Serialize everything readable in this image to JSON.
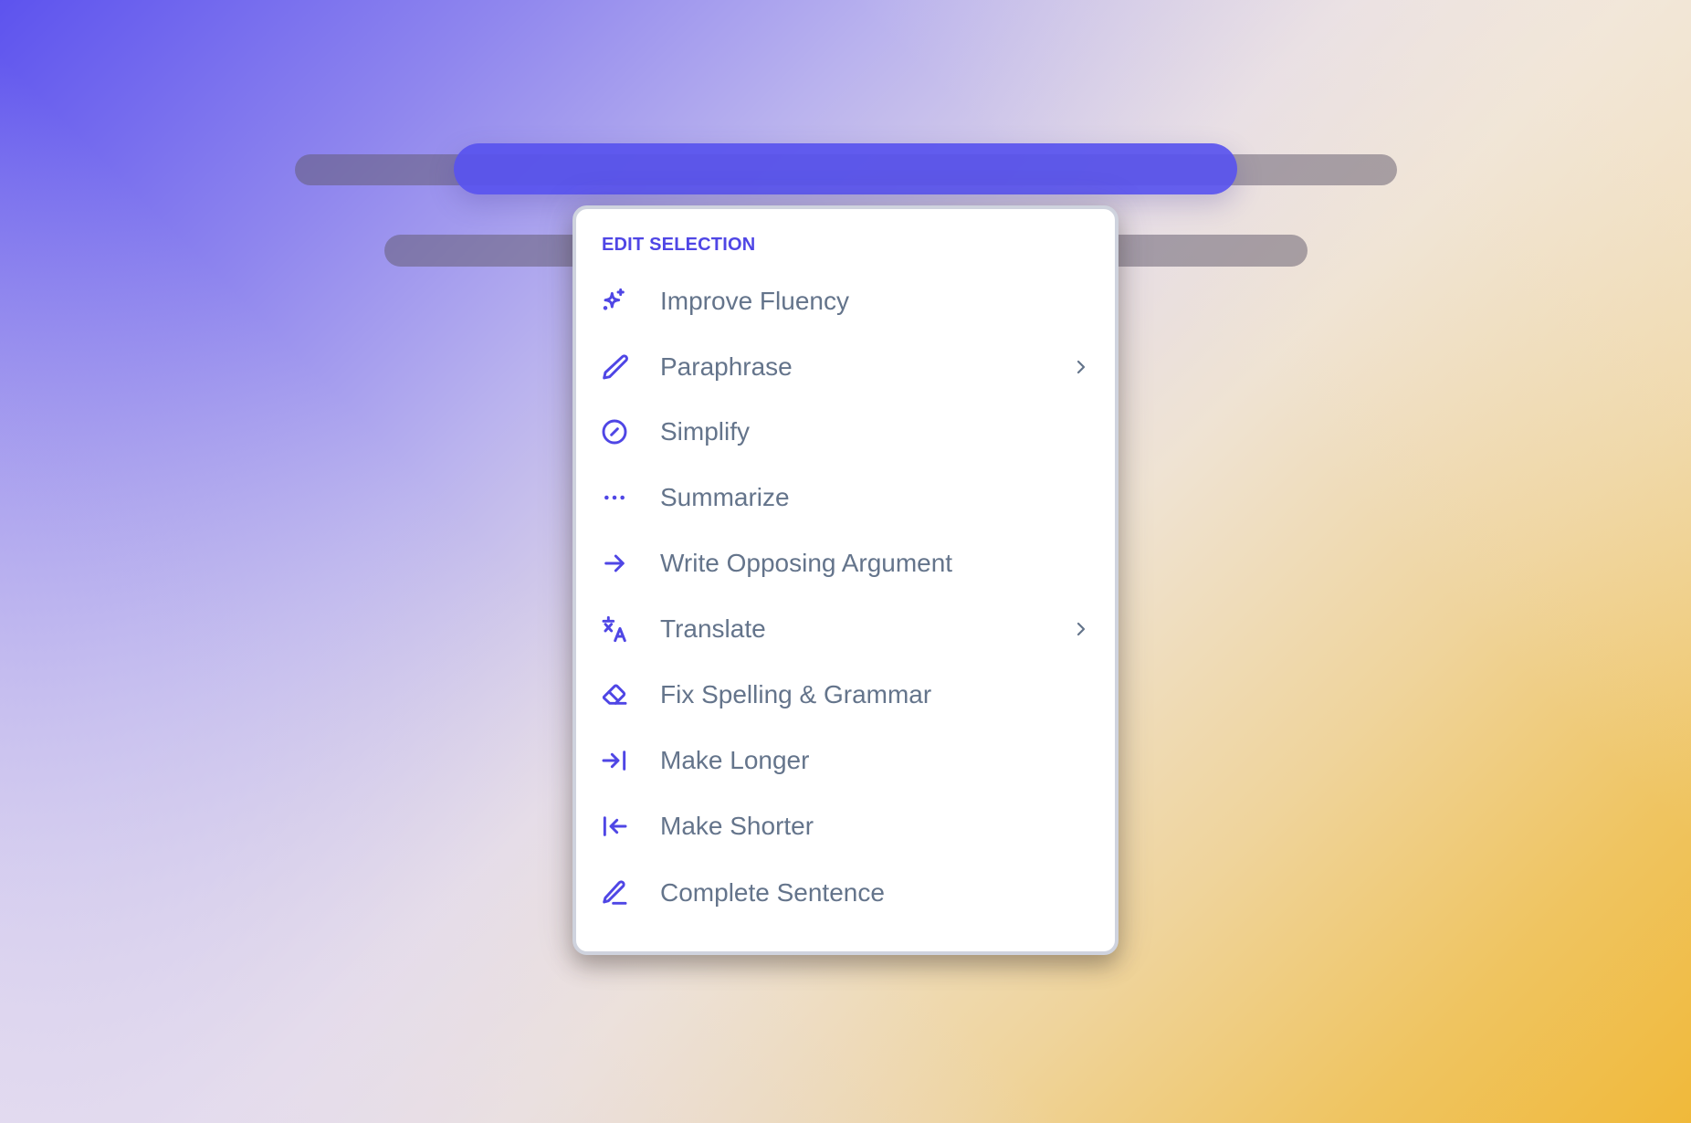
{
  "menu": {
    "header": "EDIT SELECTION",
    "accent_color": "#4f46e5",
    "text_color": "#64748b",
    "items": [
      {
        "label": "Improve Fluency",
        "icon": "sparkles-icon",
        "has_submenu": false
      },
      {
        "label": "Paraphrase",
        "icon": "pencil-icon",
        "has_submenu": true
      },
      {
        "label": "Simplify",
        "icon": "circle-slash-icon",
        "has_submenu": false
      },
      {
        "label": "Summarize",
        "icon": "dots-horizontal-icon",
        "has_submenu": false
      },
      {
        "label": "Write Opposing Argument",
        "icon": "arrow-right-icon",
        "has_submenu": false
      },
      {
        "label": "Translate",
        "icon": "language-icon",
        "has_submenu": true
      },
      {
        "label": "Fix Spelling & Grammar",
        "icon": "eraser-icon",
        "has_submenu": false
      },
      {
        "label": "Make Longer",
        "icon": "arrow-right-to-line-icon",
        "has_submenu": false
      },
      {
        "label": "Make Shorter",
        "icon": "arrow-left-to-line-icon",
        "has_submenu": false
      },
      {
        "label": "Complete Sentence",
        "icon": "pencil-line-icon",
        "has_submenu": false
      }
    ]
  },
  "background": {
    "gradient_start": "#5d53ee",
    "gradient_end": "#f0b93a"
  },
  "selection_highlight_color": "#5852ee"
}
